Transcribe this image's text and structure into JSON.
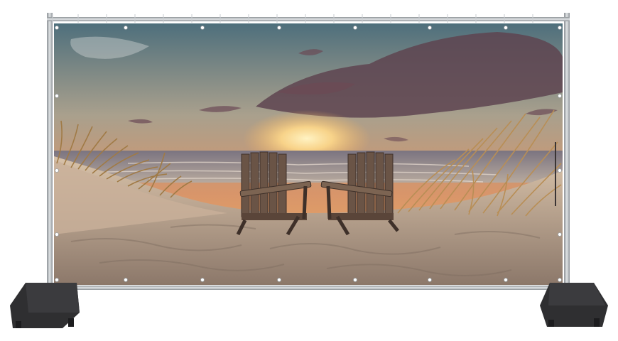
{
  "scene": {
    "subject": "mesh-fence-banner",
    "image_content": [
      "sunset-sky",
      "sea",
      "sand-dunes",
      "dune-grass",
      "two-adirondack-chairs"
    ],
    "colors": {
      "sky_top": "#4e6f7c",
      "sky_mid": "#d8956a",
      "sun_glow": "#ffd98a",
      "horizon": "#f3b15f",
      "cloud": "#5e4450",
      "sea": "#6b6f7a",
      "sand_light": "#d8c2a9",
      "sand_dark": "#7e6d60",
      "grass": "#a07a45",
      "chair": "#6a5446",
      "frame_metal": "#b8bcc0",
      "foot_block": "#2f2f31"
    }
  }
}
